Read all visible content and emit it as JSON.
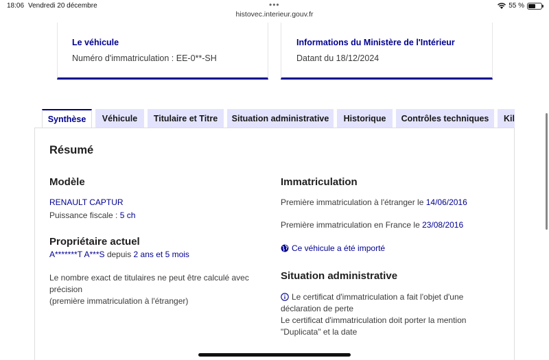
{
  "statusbar": {
    "time": "18:06",
    "date": "Vendredi 20 décembre",
    "url": "histovec.interieur.gouv.fr",
    "battery": "55 %",
    "battery_level": 0.55
  },
  "cards": {
    "vehicule": {
      "title": "Le véhicule",
      "text": "Numéro d'immatriculation : EE-0**-SH"
    },
    "ministere": {
      "title": "Informations du Ministère de l'Intérieur",
      "text": "Datant du 18/12/2024"
    }
  },
  "tabs": [
    {
      "label": "Synthèse",
      "active": true
    },
    {
      "label": "Véhicule"
    },
    {
      "label": "Titulaire et Titre"
    },
    {
      "label": "Situation administrative"
    },
    {
      "label": "Historique"
    },
    {
      "label": "Contrôles techniques"
    },
    {
      "label": "Kilo"
    }
  ],
  "resume": {
    "title": "Résumé",
    "modele": {
      "heading": "Modèle",
      "name": "RENAULT CAPTUR",
      "puissance_label": "Puissance fiscale : ",
      "puissance_value": "5 ch"
    },
    "proprietaire": {
      "heading": "Propriétaire actuel",
      "name": "A*******T A***S",
      "depuis": " depuis ",
      "duration": "2 ans et 5 mois",
      "note_line1": "Le nombre exact de titulaires ne peut être calculé avec",
      "note_line2": "précision",
      "note_line3": "(première immatriculation à l'étranger)"
    },
    "immatriculation": {
      "heading": "Immatriculation",
      "etranger_label": "Première immatriculation à l'étranger le ",
      "etranger_date": "14/06/2016",
      "france_label": "Première immatriculation en France le ",
      "france_date": "23/08/2016",
      "importe": "Ce véhicule a été importé"
    },
    "situation": {
      "heading": "Situation administrative",
      "line1": "Le certificat d'immatriculation a fait l'objet d'une",
      "line2": "déclaration de perte",
      "line3": "Le certificat d'immatriculation doit porter la mention",
      "line4": "\"Duplicata\" et la date"
    }
  }
}
